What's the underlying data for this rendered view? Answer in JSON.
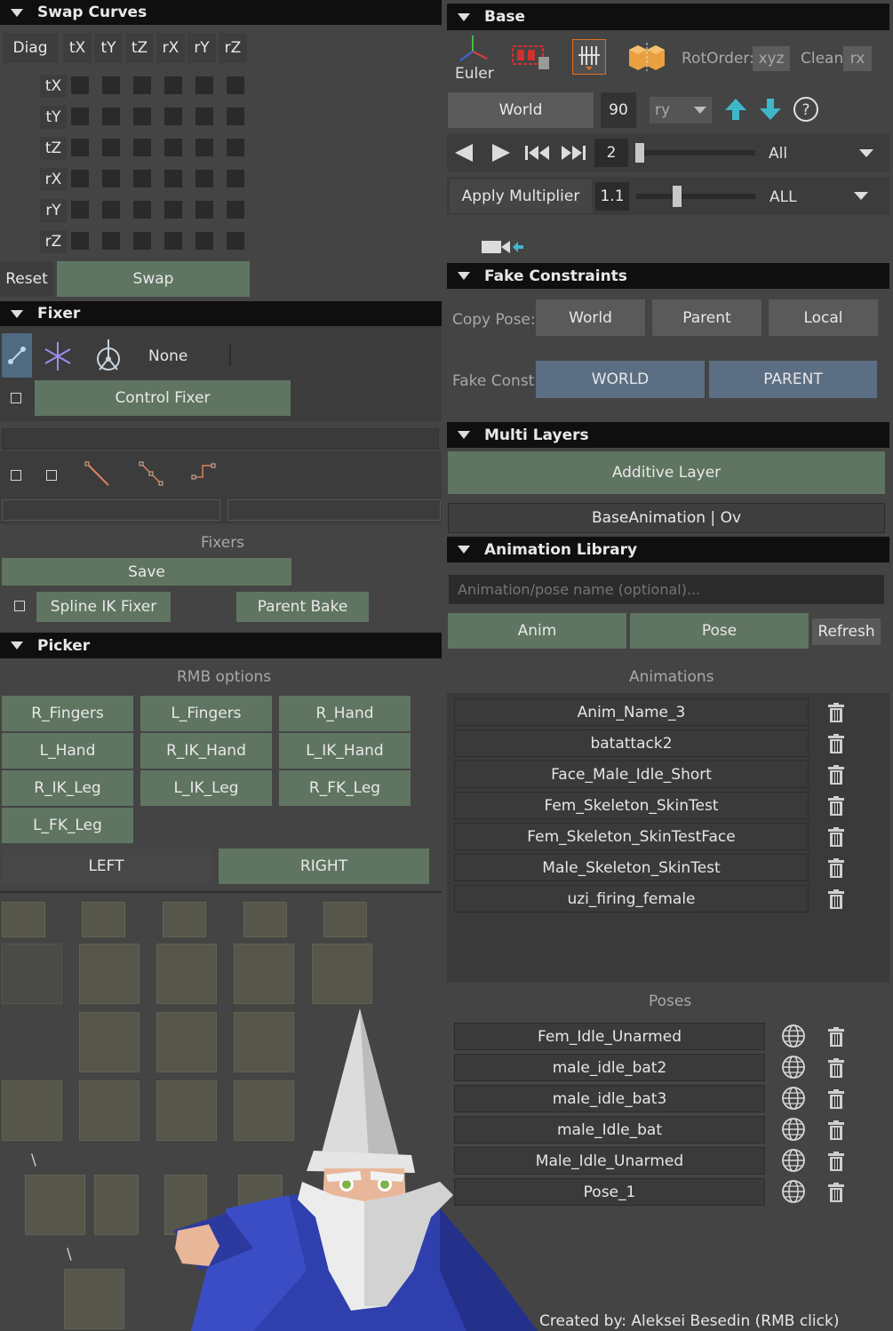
{
  "swap_curves": {
    "title": "Swap Curves",
    "diag": "Diag",
    "cols": [
      "tX",
      "tY",
      "tZ",
      "rX",
      "rY",
      "rZ"
    ],
    "rows": [
      "tX",
      "tY",
      "tZ",
      "rX",
      "rY",
      "rZ"
    ],
    "reset": "Reset",
    "swap": "Swap"
  },
  "fixer": {
    "title": "Fixer",
    "none_label": "None",
    "control_fixer": "Control Fixer",
    "fixers_label": "Fixers",
    "save": "Save",
    "spline_ik": "Spline IK Fixer",
    "parent_bake": "Parent Bake"
  },
  "picker": {
    "title": "Picker",
    "rmb_options": "RMB options",
    "buttons": [
      "R_Fingers",
      "L_Fingers",
      "R_Hand",
      "L_Hand",
      "R_IK_Hand",
      "L_IK_Hand",
      "R_IK_Leg",
      "L_IK_Leg",
      "R_FK_Leg",
      "L_FK_Leg"
    ],
    "left": "LEFT",
    "right": "RIGHT",
    "slash1": "\\",
    "slash2": "\\"
  },
  "base": {
    "title": "Base",
    "euler": "Euler",
    "rotorder_label": "RotOrder:",
    "rotorder_value": "xyz",
    "clean_label": "Clean",
    "clean_value": "rx",
    "world": "World",
    "angle": "90",
    "axis": "ry",
    "frame_step": "2",
    "frame_range": "All",
    "apply_multiplier": "Apply Multiplier",
    "multiplier": "1.1",
    "multiplier_scope": "ALL"
  },
  "fake_constraints": {
    "title": "Fake Constraints",
    "copy_pose_label": "Copy Pose:",
    "copy_world": "World",
    "copy_parent": "Parent",
    "copy_local": "Local",
    "fake_const_label": "Fake Const:",
    "fc_world": "WORLD",
    "fc_parent": "PARENT"
  },
  "multi_layers": {
    "title": "Multi Layers",
    "additive": "Additive Layer",
    "base_anim": "BaseAnimation | Ov"
  },
  "anim_library": {
    "title": "Animation Library",
    "name_placeholder": "Animation/pose name (optional)...",
    "anim": "Anim",
    "pose": "Pose",
    "refresh": "Refresh",
    "animations_label": "Animations",
    "animations": [
      "Anim_Name_3",
      "batattack2",
      "Face_Male_Idle_Short",
      "Fem_Skeleton_SkinTest",
      "Fem_Skeleton_SkinTestFace",
      "Male_Skeleton_SkinTest",
      "uzi_firing_female"
    ],
    "poses_label": "Poses",
    "poses": [
      "Fem_Idle_Unarmed",
      "male_idle_bat2",
      "male_idle_bat3",
      "male_Idle_bat",
      "Male_Idle_Unarmed",
      "Pose_1"
    ]
  },
  "footer": {
    "credit": "Created by: Aleksei Besedin (RMB click)"
  },
  "colors": {
    "green": "#5f7561",
    "blue": "#5b6e84",
    "accent_arrow": "#3fb7c9",
    "header": "#0f0f0f"
  }
}
